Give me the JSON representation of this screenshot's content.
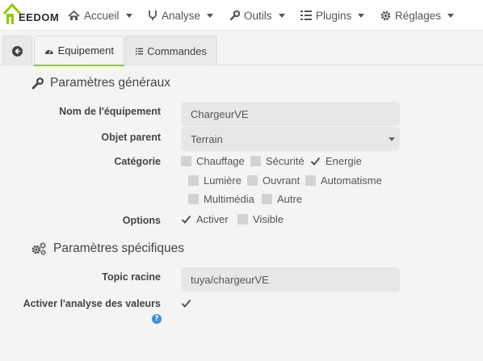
{
  "navbar": {
    "logo_text": "EEDOM",
    "items": [
      {
        "label": "Accueil",
        "icon": "home-icon"
      },
      {
        "label": "Analyse",
        "icon": "stethoscope-icon"
      },
      {
        "label": "Outils",
        "icon": "wrench-icon"
      },
      {
        "label": "Plugins",
        "icon": "tasks-icon"
      },
      {
        "label": "Réglages",
        "icon": "cog-icon"
      }
    ]
  },
  "tabs": {
    "back_icon": "circle-arrow-left-icon",
    "equipement_label": "Equipement",
    "commandes_label": "Commandes",
    "active": "Equipement",
    "accent_color": "#93ca02"
  },
  "general": {
    "title": "Paramètres généraux",
    "name_label": "Nom de l'équipement",
    "name_value": "ChargeurVE",
    "parent_label": "Objet parent",
    "parent_value": "Terrain",
    "category_label": "Catégorie",
    "categories": [
      {
        "label": "Chauffage",
        "checked": false
      },
      {
        "label": "Sécurité",
        "checked": false
      },
      {
        "label": "Energie",
        "checked": true
      },
      {
        "label": "Lumière",
        "checked": false
      },
      {
        "label": "Ouvrant",
        "checked": false
      },
      {
        "label": "Automatisme",
        "checked": false
      },
      {
        "label": "Multimédia",
        "checked": false
      },
      {
        "label": "Autre",
        "checked": false
      }
    ],
    "options_label": "Options",
    "options": [
      {
        "label": "Activer",
        "checked": true
      },
      {
        "label": "Visible",
        "checked": false
      }
    ]
  },
  "specific": {
    "title": "Paramètres spécifiques",
    "topic_label": "Topic racine",
    "topic_value": "tuya/chargeurVE",
    "analyse_label": "Activer l'analyse des valeurs",
    "analyse_checked": true,
    "help_icon": "question-circle-icon"
  }
}
